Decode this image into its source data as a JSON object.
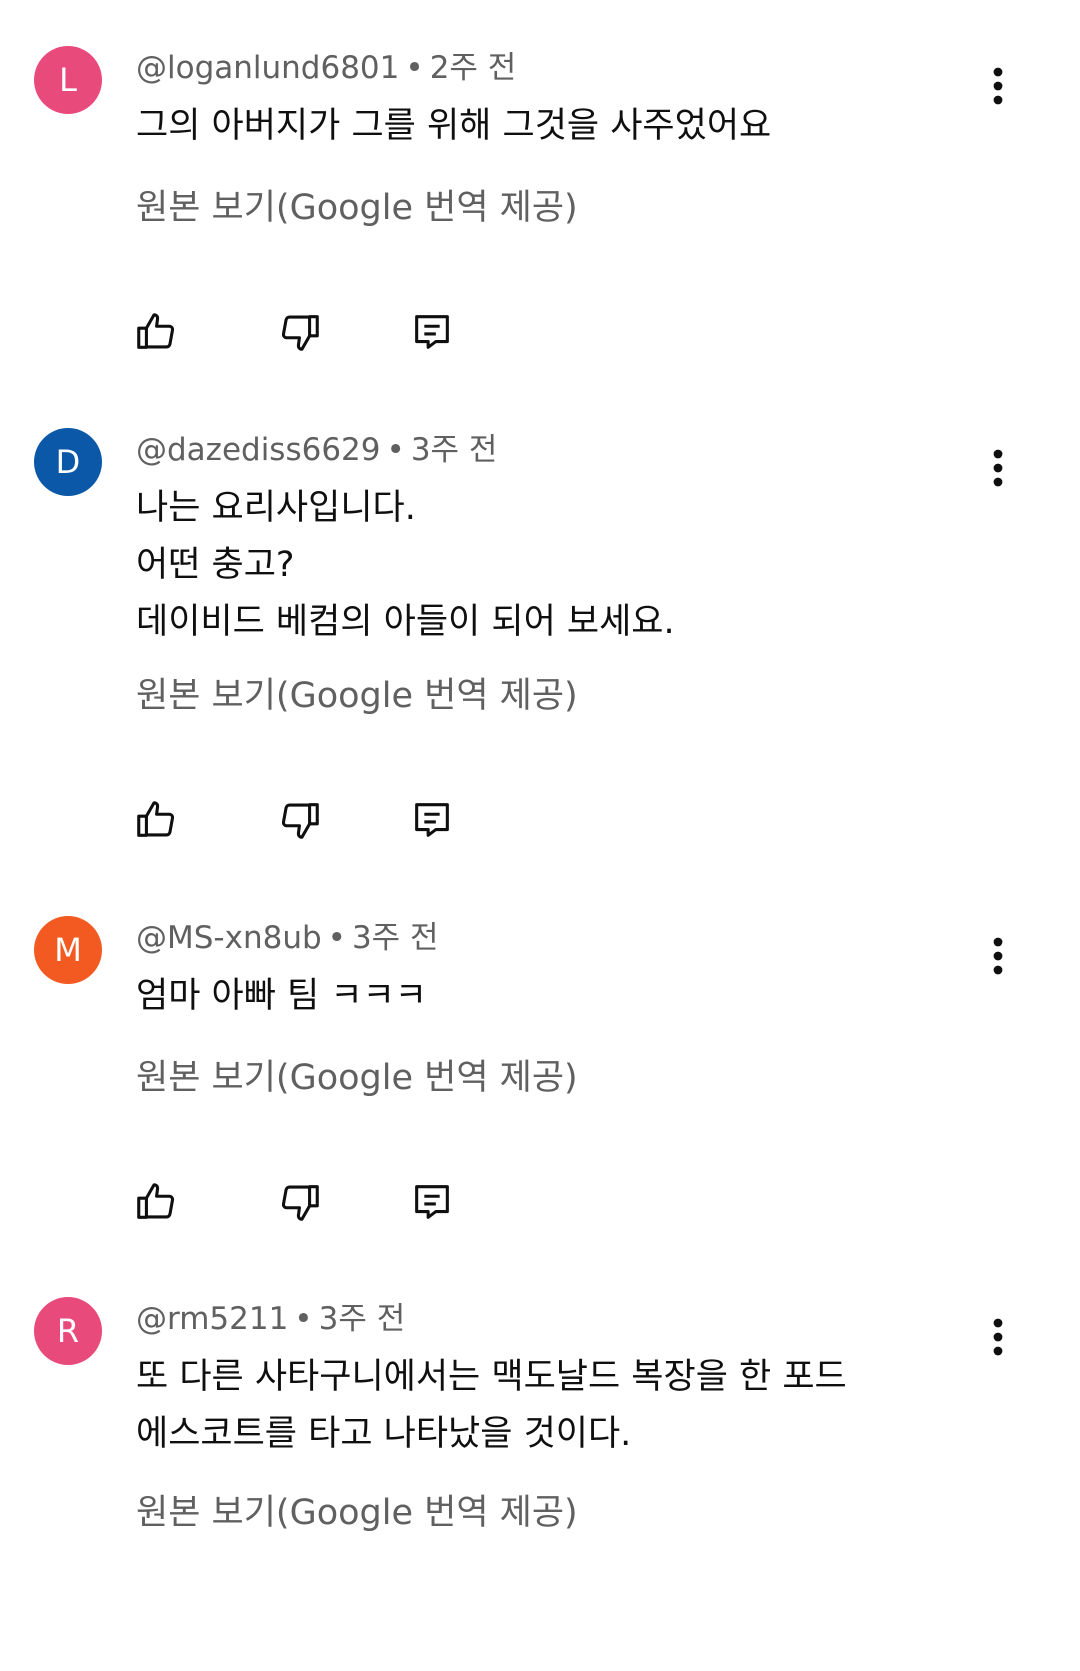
{
  "comments": [
    {
      "avatar_letter": "L",
      "avatar_color": "#e84a7b",
      "username": "@loganlund6801",
      "separator": "•",
      "time": "2주 전",
      "lines": [
        "그의 아버지가 그를 위해 그것을 사주었어요"
      ],
      "translate_label": "원본 보기(Google 번역 제공)"
    },
    {
      "avatar_letter": "D",
      "avatar_color": "#0b58a8",
      "username": "@dazediss6629",
      "separator": "•",
      "time": "3주 전",
      "lines": [
        "나는 요리사입니다.",
        "어떤 충고?",
        "데이비드 베컴의 아들이 되어 보세요."
      ],
      "translate_label": "원본 보기(Google 번역 제공)"
    },
    {
      "avatar_letter": "M",
      "avatar_color": "#f25a22",
      "username": "@MS-xn8ub",
      "separator": "•",
      "time": "3주 전",
      "lines": [
        "엄마 아빠 팀 ㅋㅋㅋ"
      ],
      "translate_label": "원본 보기(Google 번역 제공)"
    },
    {
      "avatar_letter": "R",
      "avatar_color": "#e84a7b",
      "username": "@rm5211",
      "separator": "•",
      "time": "3주 전",
      "lines": [
        "또 다른 사타구니에서는 맥도날드 복장을 한 포드",
        "에스코트를 타고 나타났을 것이다."
      ],
      "translate_label": "원본 보기(Google 번역 제공)"
    }
  ],
  "icons": {
    "like": "thumb-up-icon",
    "dislike": "thumb-down-icon",
    "reply": "reply-comment-icon",
    "more": "more-vertical-icon"
  },
  "colors": {
    "text_primary": "#0f0f0f",
    "text_secondary": "#606060"
  }
}
